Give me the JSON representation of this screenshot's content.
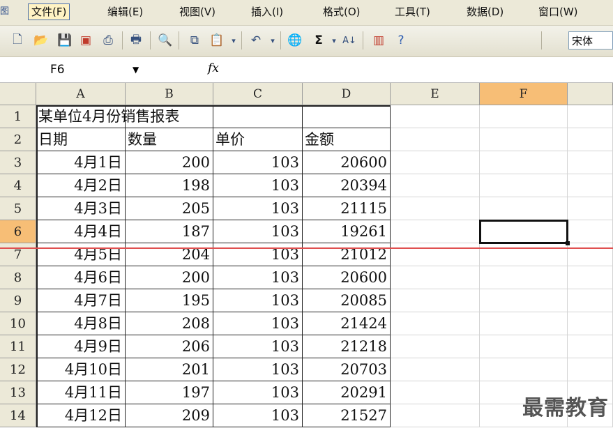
{
  "menu": {
    "app_icon": "图",
    "items": [
      "文件(F)",
      "编辑(E)",
      "视图(V)",
      "插入(I)",
      "格式(O)",
      "工具(T)",
      "数据(D)",
      "窗口(W)"
    ]
  },
  "toolbar": {
    "font_name": "宋体",
    "icons": [
      "new-icon",
      "open-icon",
      "save-icon",
      "permission-icon",
      "print-preview-icon",
      "print-icon",
      "research-icon",
      "copy-icon",
      "paste-icon",
      "undo-icon",
      "hyperlink-icon",
      "autosum-icon",
      "sort-ascending-icon",
      "chart-wizard-icon",
      "help-icon"
    ]
  },
  "formula_bar": {
    "name_box": "F6",
    "fx": "fx",
    "formula": ""
  },
  "sheet": {
    "columns": [
      "A",
      "B",
      "C",
      "D",
      "E",
      "F"
    ],
    "selected_column": "F",
    "selected_row": "6",
    "rows": [
      {
        "n": "1",
        "a": "某单位4月份销售报表",
        "b": "",
        "c": "",
        "d": ""
      },
      {
        "n": "2",
        "a": "日期",
        "b": "数量",
        "c": "单价",
        "d": "金额"
      },
      {
        "n": "3",
        "a": "4月1日",
        "b": "200",
        "c": "103",
        "d": "20600"
      },
      {
        "n": "4",
        "a": "4月2日",
        "b": "198",
        "c": "103",
        "d": "20394"
      },
      {
        "n": "5",
        "a": "4月3日",
        "b": "205",
        "c": "103",
        "d": "21115"
      },
      {
        "n": "6",
        "a": "4月4日",
        "b": "187",
        "c": "103",
        "d": "19261"
      },
      {
        "n": "7",
        "a": "4月5日",
        "b": "204",
        "c": "103",
        "d": "21012"
      },
      {
        "n": "8",
        "a": "4月6日",
        "b": "200",
        "c": "103",
        "d": "20600"
      },
      {
        "n": "9",
        "a": "4月7日",
        "b": "195",
        "c": "103",
        "d": "20085"
      },
      {
        "n": "10",
        "a": "4月8日",
        "b": "208",
        "c": "103",
        "d": "21424"
      },
      {
        "n": "11",
        "a": "4月9日",
        "b": "206",
        "c": "103",
        "d": "21218"
      },
      {
        "n": "12",
        "a": "4月10日",
        "b": "201",
        "c": "103",
        "d": "20703"
      },
      {
        "n": "13",
        "a": "4月11日",
        "b": "197",
        "c": "103",
        "d": "20291"
      },
      {
        "n": "14",
        "a": "4月12日",
        "b": "209",
        "c": "103",
        "d": "21527"
      }
    ]
  },
  "watermark": "最需教育"
}
